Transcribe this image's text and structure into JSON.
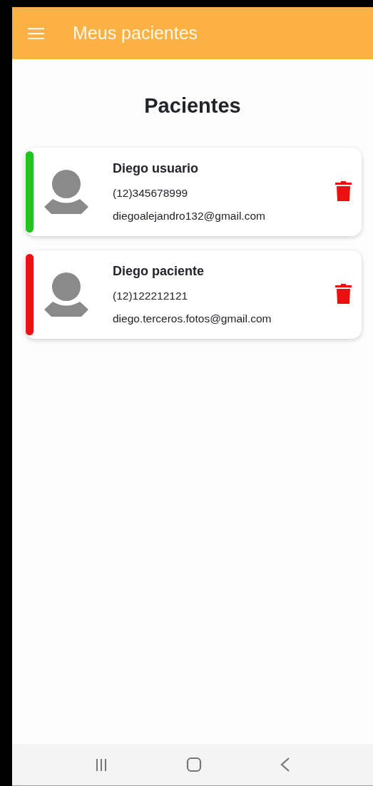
{
  "app_bar": {
    "title": "Meus pacientes"
  },
  "heading": "Pacientes",
  "patients": [
    {
      "name": "Diego usuario",
      "phone": "(12)345678999",
      "email": "diegoalejandro132@gmail.com",
      "color": "#22c322"
    },
    {
      "name": "Diego paciente",
      "phone": "(12)122212121",
      "email": "diego.terceros.fotos@gmail.com",
      "color": "#ee1111"
    }
  ]
}
